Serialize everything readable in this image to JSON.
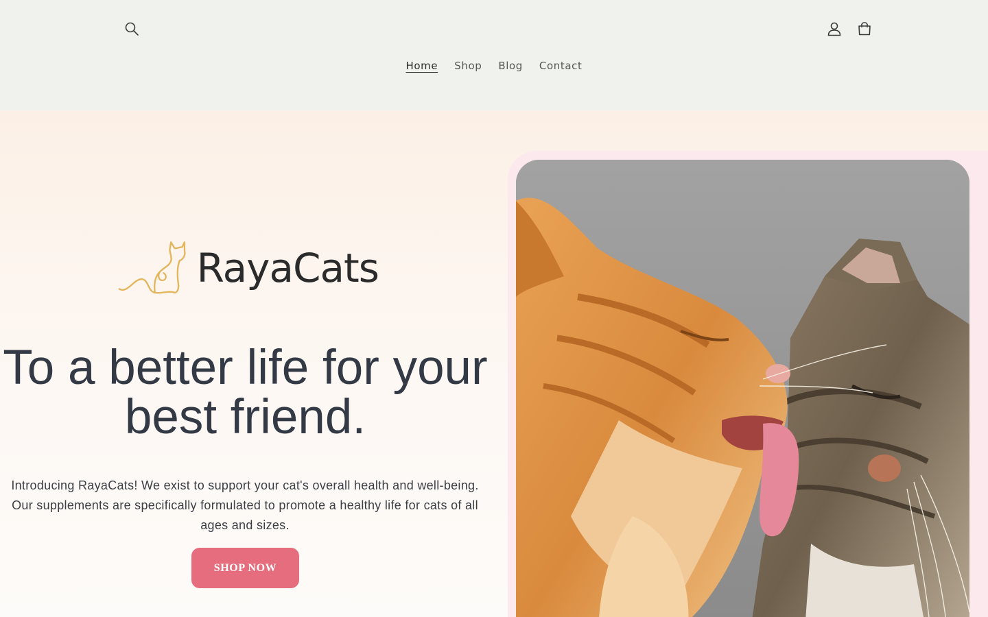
{
  "header": {
    "search_label": "Search",
    "account_label": "Log in",
    "cart_label": "Cart",
    "nav": [
      {
        "label": "Home",
        "active": true
      },
      {
        "label": "Shop",
        "active": false
      },
      {
        "label": "Blog",
        "active": false
      },
      {
        "label": "Contact",
        "active": false
      }
    ]
  },
  "hero": {
    "brand": "RayaCats",
    "headline": "To a better life for your best friend.",
    "intro": "Introducing RayaCats! We exist to support your cat's overall health and well-being. Our supplements are specifically formulated to promote a healthy life for cats of all ages and sizes.",
    "cta": "SHOP NOW",
    "image_icon": "two-cats-grooming-photo"
  },
  "colors": {
    "header_bg": "#f0f2ed",
    "hero_bg_top": "#fcf0e6",
    "accent": "#e66d7e",
    "logo_gold": "#e4b65c",
    "text_dark": "#333a45"
  }
}
